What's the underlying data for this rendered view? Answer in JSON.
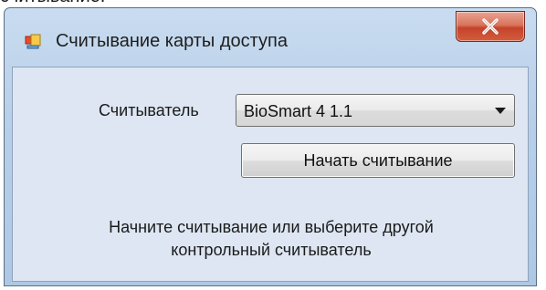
{
  "window": {
    "title": "Считывание карты доступа",
    "icon": "app-window-icon",
    "close_icon": "close-icon"
  },
  "form": {
    "reader_label": "Считыватель",
    "reader_value": "BioSmart 4 1.1",
    "start_button_label": "Начать считывание",
    "hint_line1": "Начните считывание или выберите другой",
    "hint_line2": "контрольный считыватель"
  }
}
